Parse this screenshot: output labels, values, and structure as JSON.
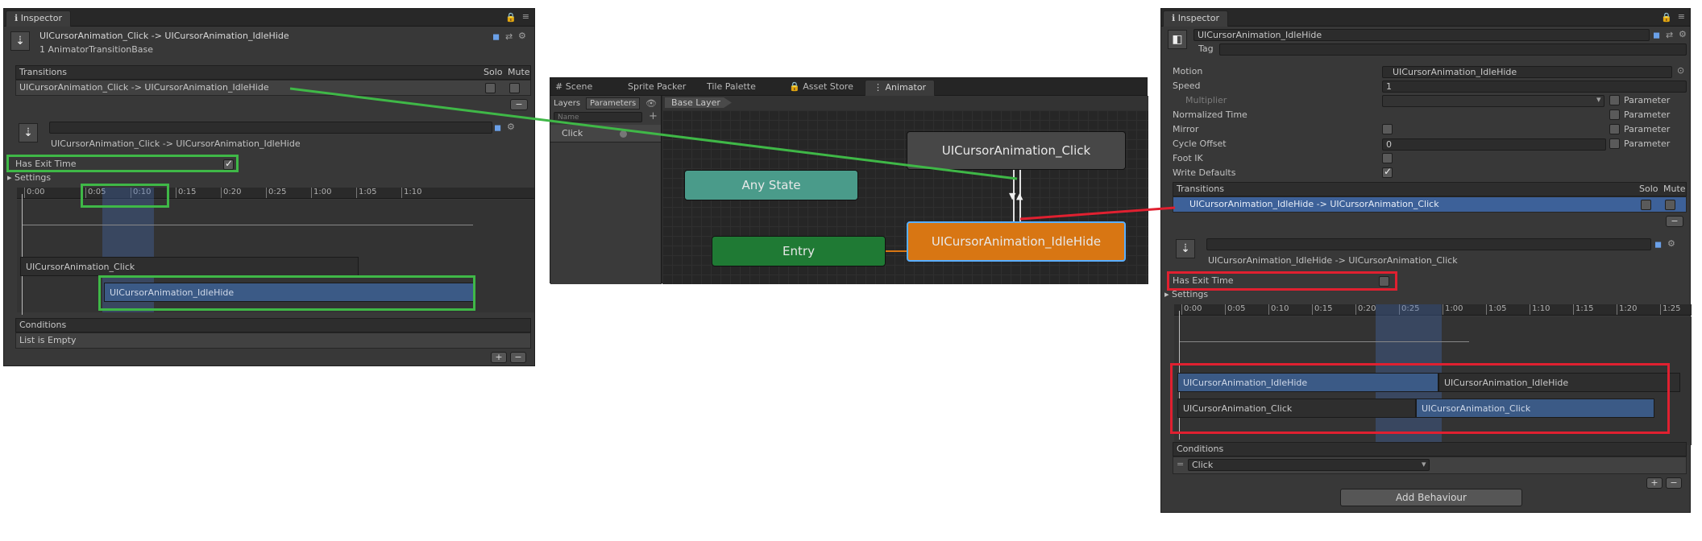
{
  "left_inspector": {
    "tab": "Inspector",
    "title": "UICursorAnimation_Click -> UICursorAnimation_IdleHide",
    "subtitle": "1 AnimatorTransitionBase",
    "transitions_header": "Transitions",
    "solo": "Solo",
    "mute": "Mute",
    "transition_item": "UICursorAnimation_Click -> UICursorAnimation_IdleHide",
    "minus": "−",
    "transition_name": "UICursorAnimation_Click -> UICursorAnimation_IdleHide",
    "has_exit_time": "Has Exit Time",
    "settings": "Settings",
    "ticks": [
      "0:00",
      "0:05",
      "0:10",
      "0:15",
      "0:20",
      "0:25",
      "1:00",
      "1:05",
      "1:10"
    ],
    "clip_source": "UICursorAnimation_Click",
    "clip_target": "UICursorAnimation_IdleHide",
    "conditions_header": "Conditions",
    "conditions_empty": "List is Empty",
    "plus": "+"
  },
  "animator": {
    "tabs": {
      "scene": "Scene",
      "sprite_packer": "Sprite Packer",
      "tile_palette": "Tile Palette",
      "asset_store": "Asset Store",
      "animator": "Animator"
    },
    "layers_tab": "Layers",
    "parameters_tab": "Parameters",
    "base_layer": "Base Layer",
    "search_placeholder": "Name",
    "param_name": "Click",
    "nodes": {
      "any_state": "Any State",
      "entry": "Entry",
      "click": "UICursorAnimation_Click",
      "idle_hide": "UICursorAnimation_IdleHide"
    }
  },
  "right_inspector": {
    "tab": "Inspector",
    "name": "UICursorAnimation_IdleHide",
    "tag": "Tag",
    "props": [
      {
        "label": "Motion",
        "value": "UICursorAnimation_IdleHide"
      },
      {
        "label": "Speed",
        "value": "1"
      },
      {
        "label": "Multiplier",
        "value": ""
      },
      {
        "label": "Normalized Time",
        "value": ""
      },
      {
        "label": "Mirror",
        "value": ""
      },
      {
        "label": "Cycle Offset",
        "value": "0"
      },
      {
        "label": "Foot IK",
        "value": ""
      },
      {
        "label": "Write Defaults",
        "value": ""
      }
    ],
    "parameter": "Parameter",
    "transitions_header": "Transitions",
    "solo": "Solo",
    "mute": "Mute",
    "transition_item": "UICursorAnimation_IdleHide -> UICursorAnimation_Click",
    "minus": "−",
    "transition_name": "UICursorAnimation_IdleHide -> UICursorAnimation_Click",
    "has_exit_time": "Has Exit Time",
    "settings": "Settings",
    "ticks": [
      "0:00",
      "0:05",
      "0:10",
      "0:15",
      "0:20",
      "0:25",
      "1:00",
      "1:05",
      "1:10",
      "1:15",
      "1:20",
      "1:25"
    ],
    "clip_source_a": "UICursorAnimation_IdleHide",
    "clip_source_b": "UICursorAnimation_IdleHide",
    "clip_target_a": "UICursorAnimation_Click",
    "clip_target_b": "UICursorAnimation_Click",
    "conditions_header": "Conditions",
    "condition": "Click",
    "plus": "+",
    "add_behaviour": "Add Behaviour"
  },
  "colors": {
    "green_highlight": "#3fb847",
    "red_highlight": "#e02030",
    "idle_hide_node": "#d87613",
    "entry_node": "#1f7a34",
    "any_state_node": "#4a9b8a",
    "selection": "#3d6199"
  }
}
